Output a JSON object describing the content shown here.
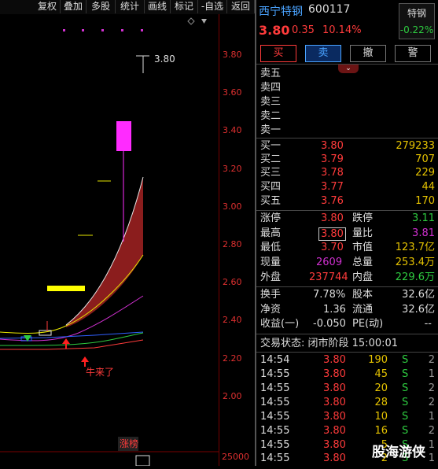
{
  "toolbar": {
    "buttons": [
      "复权",
      "叠加",
      "多股",
      "统计",
      "画线",
      "标记",
      "-自选",
      "返回"
    ]
  },
  "chart": {
    "y_ticks": [
      "3.80",
      "3.60",
      "3.40",
      "3.20",
      "3.00",
      "2.80",
      "2.60",
      "2.40",
      "2.20",
      "2.00"
    ],
    "volume_tick": "25000",
    "high_label": "3.80",
    "annotation": "牛来了",
    "zhangbang": "涨榜"
  },
  "stock": {
    "name": "西宁特钢",
    "code": "600117",
    "price": "3.80",
    "change": "0.35",
    "change_pct": "10.14%",
    "tag_label": "特钢",
    "tag_value": "-0.22%"
  },
  "actions": {
    "buy": "买",
    "sell": "卖",
    "cancel": "撤",
    "alert": "警"
  },
  "asks": [
    {
      "label": "卖五",
      "price": "",
      "vol": ""
    },
    {
      "label": "卖四",
      "price": "",
      "vol": ""
    },
    {
      "label": "卖三",
      "price": "",
      "vol": ""
    },
    {
      "label": "卖二",
      "price": "",
      "vol": ""
    },
    {
      "label": "卖一",
      "price": "",
      "vol": ""
    }
  ],
  "bids": [
    {
      "label": "买一",
      "price": "3.80",
      "vol": "279233"
    },
    {
      "label": "买二",
      "price": "3.79",
      "vol": "707"
    },
    {
      "label": "买三",
      "price": "3.78",
      "vol": "229"
    },
    {
      "label": "买四",
      "price": "3.77",
      "vol": "44"
    },
    {
      "label": "买五",
      "price": "3.76",
      "vol": "170"
    }
  ],
  "stats": {
    "zt_label": "涨停",
    "zt": "3.80",
    "dt_label": "跌停",
    "dt": "3.11",
    "high_label": "最高",
    "high": "3.80",
    "lb_label": "量比",
    "lb": "3.81",
    "low_label": "最低",
    "low": "3.70",
    "sz_label": "市值",
    "sz": "123.7亿",
    "xl_label": "现量",
    "xl": "2609",
    "zl_label": "总量",
    "zl": "253.4万",
    "wp_label": "外盘",
    "wp": "237744",
    "np_label": "内盘",
    "np": "229.6万"
  },
  "fund": {
    "hs_label": "换手",
    "hs": "7.78%",
    "gb_label": "股本",
    "gb": "32.6亿",
    "jz_label": "净资",
    "jz": "1.36",
    "lt_label": "流通",
    "lt": "32.6亿",
    "sy_label": "收益(一)",
    "sy": "-0.050",
    "pe_label": "PE(动)",
    "pe": "--"
  },
  "trade_status": "交易状态: 闭市阶段 15:00:01",
  "ticks": [
    {
      "t": "14:54",
      "p": "3.80",
      "v": "190",
      "bs": "S",
      "n": "2"
    },
    {
      "t": "14:55",
      "p": "3.80",
      "v": "45",
      "bs": "S",
      "n": "1"
    },
    {
      "t": "14:55",
      "p": "3.80",
      "v": "20",
      "bs": "S",
      "n": "2"
    },
    {
      "t": "14:55",
      "p": "3.80",
      "v": "28",
      "bs": "S",
      "n": "2"
    },
    {
      "t": "14:55",
      "p": "3.80",
      "v": "10",
      "bs": "S",
      "n": "1"
    },
    {
      "t": "14:55",
      "p": "3.80",
      "v": "16",
      "bs": "S",
      "n": "2"
    },
    {
      "t": "14:55",
      "p": "3.80",
      "v": "5",
      "bs": "S",
      "n": "1"
    },
    {
      "t": "14:55",
      "p": "3.80",
      "v": "2",
      "bs": "S",
      "n": "1"
    }
  ],
  "watermark": "股海游侠"
}
